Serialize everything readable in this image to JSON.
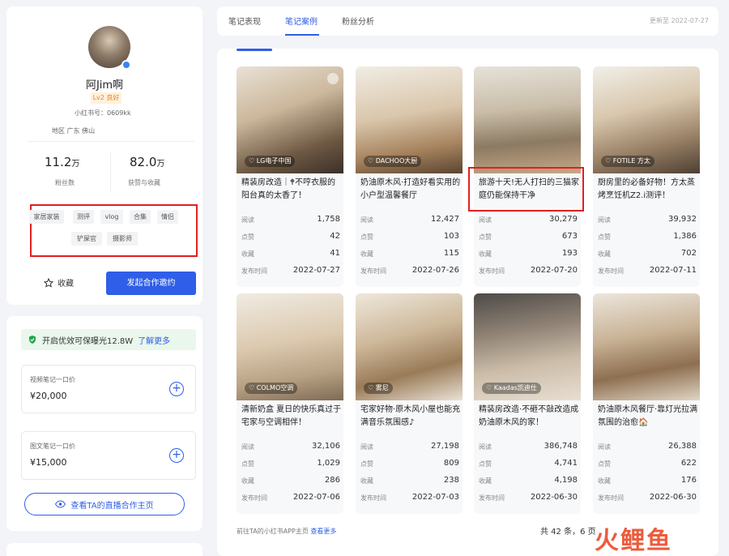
{
  "profile": {
    "name": "阿Jim啊",
    "level": "Lv2 良好",
    "rednote_id": "小红书号：0609kk",
    "region": "地区 广东 佛山",
    "followers_value": "11.2",
    "followers_unit": "万",
    "followers_label": "粉丝数",
    "likes_value": "82.0",
    "likes_unit": "万",
    "likes_label": "获赞与收藏",
    "tags": [
      "家居家装",
      "测评",
      "vlog",
      "合集",
      "情侣",
      "铲屎官",
      "摄影师"
    ],
    "favorite_label": "收藏",
    "invite_button": "发起合作邀约"
  },
  "pricing": {
    "promo_text": "开启优效可保曝光12.8W",
    "promo_link": "了解更多",
    "video_label": "视频笔记一口价",
    "video_price": "¥20,000",
    "image_label": "图文笔记一口价",
    "image_price": "¥15,000",
    "live_button": "查看TA的直播合作主页"
  },
  "tabs": {
    "items": [
      "笔记表现",
      "笔记案例",
      "粉丝分析"
    ],
    "active": "笔记案例",
    "updated": "更新至 2022-07-27"
  },
  "metric_labels": {
    "read": "阅读",
    "like": "点赞",
    "collect": "收藏",
    "date": "发布时间"
  },
  "notes": [
    {
      "brand": "LG电子中国",
      "title": "精装房改造｜🕈不哼衣服的阳台真的太香了！",
      "read": "1,758",
      "like": "42",
      "collect": "41",
      "date": "2022-07-27"
    },
    {
      "brand": "DACHOO大厨",
      "title": "奶油原木风·打造好看实用的小户型温馨餐厅",
      "read": "12,427",
      "like": "103",
      "collect": "115",
      "date": "2022-07-26"
    },
    {
      "brand": "",
      "title": "旅游十天!无人打扫的三猫家庭仍能保持干净",
      "read": "30,279",
      "like": "673",
      "collect": "193",
      "date": "2022-07-20"
    },
    {
      "brand": "FOTILE 方太",
      "title": "厨房里的必备好物！方太蒸烤烹饪机Z2.i测评！",
      "read": "39,932",
      "like": "1,386",
      "collect": "702",
      "date": "2022-07-11"
    },
    {
      "brand": "COLMO空调",
      "title": "清新奶盒 夏日的快乐真过于宅家与空调相伴！",
      "read": "32,106",
      "like": "1,029",
      "collect": "286",
      "date": "2022-07-06"
    },
    {
      "brand": "雾尼",
      "title": "宅家好物·原木风小屋也能充满音乐氛围感♪",
      "read": "27,198",
      "like": "809",
      "collect": "238",
      "date": "2022-07-03"
    },
    {
      "brand": "Kaadas凯迪仕",
      "title": "精装房改造·不砸不敲改造成奶油原木风的家！",
      "read": "386,748",
      "like": "4,741",
      "collect": "4,198",
      "date": "2022-06-30"
    },
    {
      "brand": "",
      "title": "奶油原木风餐厅·靠灯光拉满氛围的治愈🏠",
      "read": "26,388",
      "like": "622",
      "collect": "176",
      "date": "2022-06-30"
    }
  ],
  "footer": {
    "link_prefix": "前往TA的小红书APP主页",
    "link_text": "查看更多",
    "total": "共 42 条，6 页"
  },
  "watermark": "火鲤鱼",
  "colors": {
    "accent": "#2f5ee8",
    "highlight_box": "#e02020",
    "level_badge": "#e8890c"
  }
}
